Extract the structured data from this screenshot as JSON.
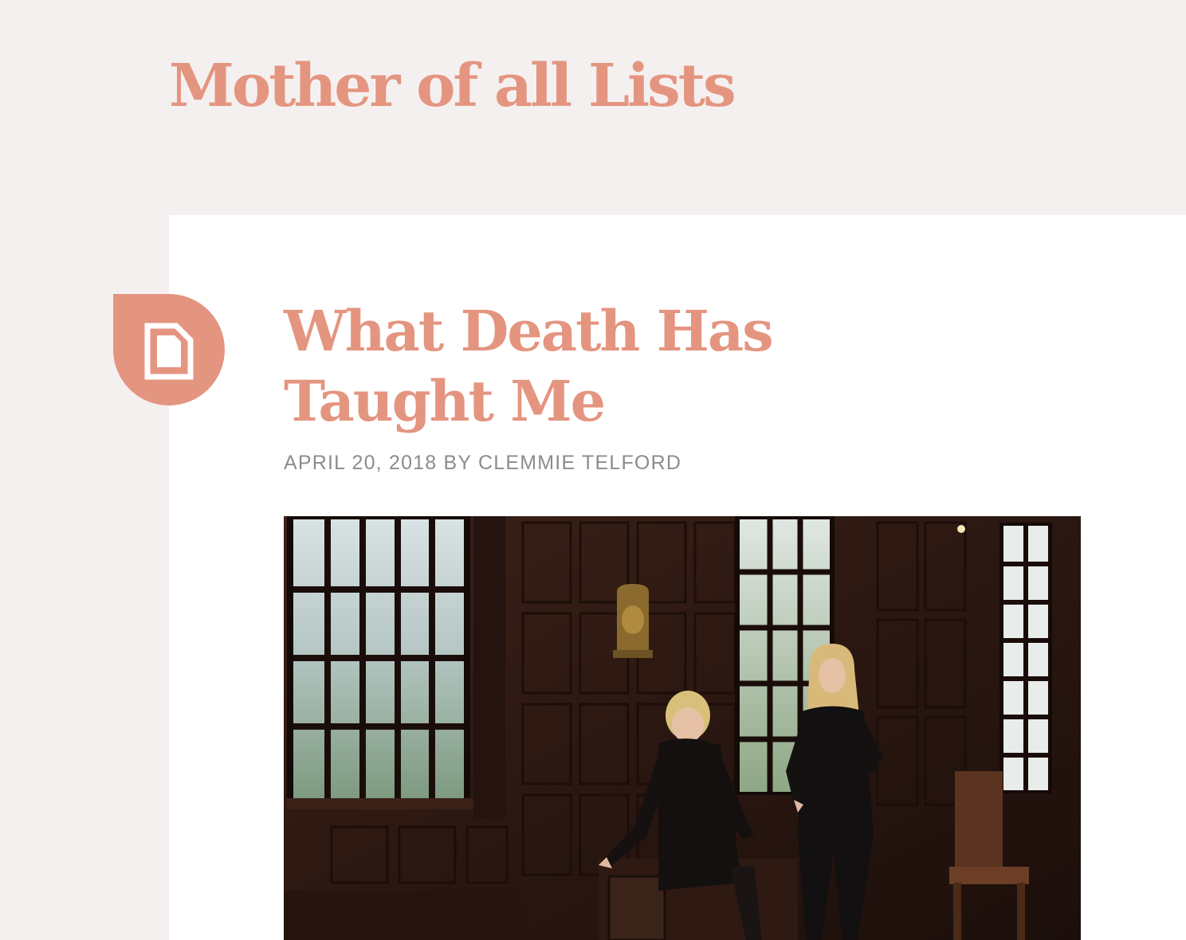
{
  "site": {
    "title": "Mother of all Lists"
  },
  "post": {
    "format_icon": "document-icon",
    "title_lines": [
      "What Death Has",
      "Taught Me"
    ],
    "date": "APRIL 20, 2018",
    "by": "BY",
    "author": "CLEMMIE TELFORD"
  },
  "colors": {
    "page_background": "#f5f0f0",
    "card_background": "#ffffff",
    "accent": "#e49580",
    "meta_text": "#8c8c8c"
  }
}
